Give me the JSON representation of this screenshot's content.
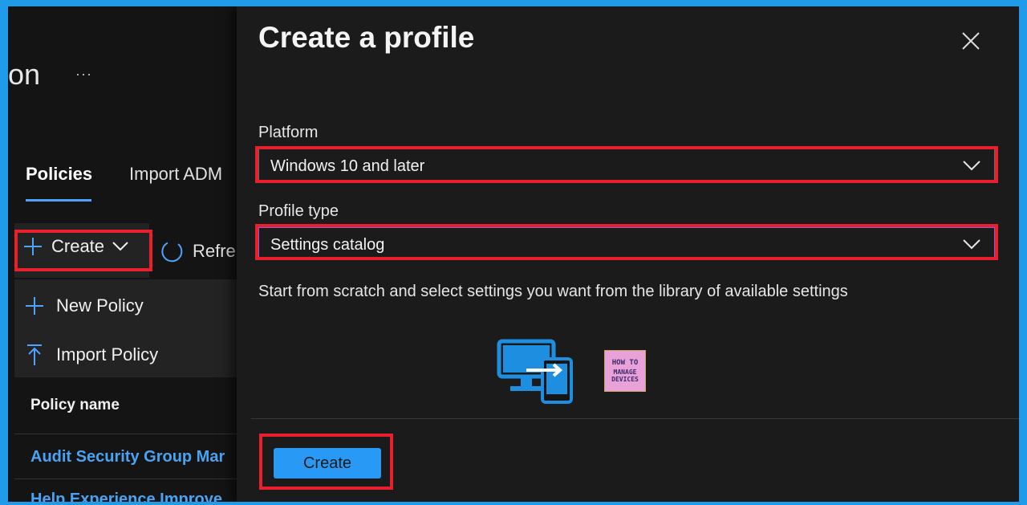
{
  "background_page": {
    "title_fragment": "on",
    "more_label": "···",
    "tabs": [
      {
        "label": "Policies",
        "active": true
      },
      {
        "label": "Import ADM"
      }
    ],
    "create_button": {
      "label": "Create"
    },
    "refresh_label": "Refre",
    "dropdown_menu": {
      "items": [
        {
          "label": "New Policy",
          "icon": "plus-icon"
        },
        {
          "label": "Import Policy",
          "icon": "upload-icon"
        }
      ]
    },
    "table": {
      "column_header": "Policy name",
      "rows": [
        "Audit Security Group Mar",
        "Help Experience Improve"
      ]
    }
  },
  "panel": {
    "title": "Create a profile",
    "close_icon": "close-icon",
    "platform": {
      "label": "Platform",
      "value": "Windows 10 and later"
    },
    "profile_type": {
      "label": "Profile type",
      "value": "Settings catalog"
    },
    "description": "Start from scratch and select settings you want from the library of available settings",
    "watermark": {
      "line1": "HOW TO",
      "line2": "MANAGE",
      "line3": "DEVICES"
    },
    "create_button_label": "Create"
  },
  "colors": {
    "accent": "#2899f5",
    "highlight": "#e8202e",
    "link": "#4aa3f2",
    "frame": "#1f9bea"
  }
}
